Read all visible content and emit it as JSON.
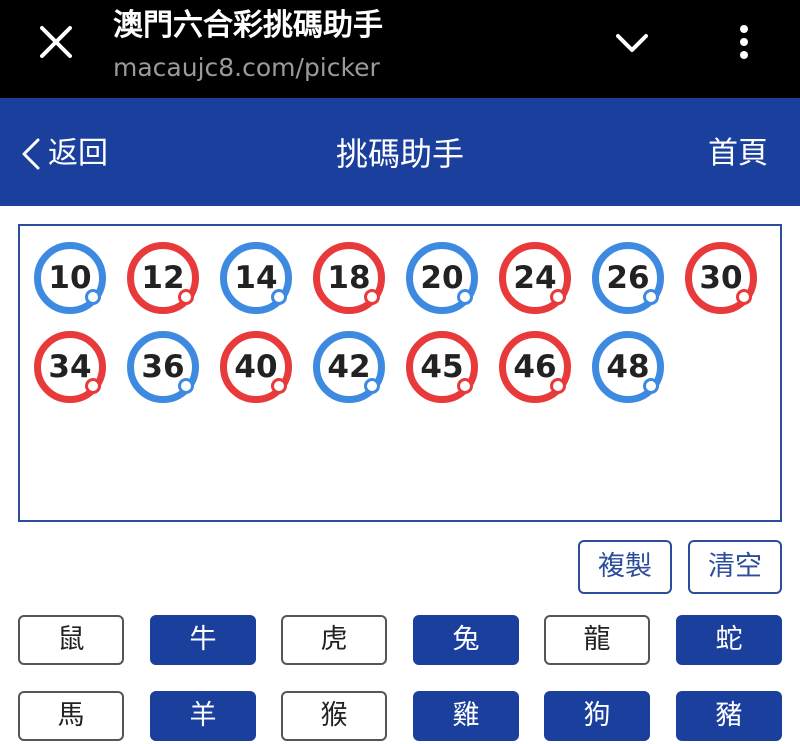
{
  "browser": {
    "title": "澳門六合彩挑碼助手",
    "url": "macaujc8.com/picker"
  },
  "header": {
    "back_label": "返回",
    "title": "挑碼助手",
    "home_label": "首頁"
  },
  "colors": {
    "brand": "#1b3f9c",
    "red_ball": "#e8393b",
    "blue_ball": "#3d8ae0"
  },
  "selected_numbers": [
    {
      "number": "10",
      "color": "blue"
    },
    {
      "number": "12",
      "color": "red"
    },
    {
      "number": "14",
      "color": "blue"
    },
    {
      "number": "18",
      "color": "red"
    },
    {
      "number": "20",
      "color": "blue"
    },
    {
      "number": "24",
      "color": "red"
    },
    {
      "number": "26",
      "color": "blue"
    },
    {
      "number": "30",
      "color": "red"
    },
    {
      "number": "34",
      "color": "red"
    },
    {
      "number": "36",
      "color": "blue"
    },
    {
      "number": "40",
      "color": "red"
    },
    {
      "number": "42",
      "color": "blue"
    },
    {
      "number": "45",
      "color": "red"
    },
    {
      "number": "46",
      "color": "red"
    },
    {
      "number": "48",
      "color": "blue"
    }
  ],
  "actions": {
    "copy_label": "複製",
    "clear_label": "清空"
  },
  "zodiac": [
    {
      "label": "鼠",
      "selected": false
    },
    {
      "label": "牛",
      "selected": true
    },
    {
      "label": "虎",
      "selected": false
    },
    {
      "label": "兔",
      "selected": true
    },
    {
      "label": "龍",
      "selected": false
    },
    {
      "label": "蛇",
      "selected": true
    },
    {
      "label": "馬",
      "selected": false
    },
    {
      "label": "羊",
      "selected": true
    },
    {
      "label": "猴",
      "selected": false
    },
    {
      "label": "雞",
      "selected": true
    },
    {
      "label": "狗",
      "selected": true
    },
    {
      "label": "豬",
      "selected": true
    }
  ]
}
